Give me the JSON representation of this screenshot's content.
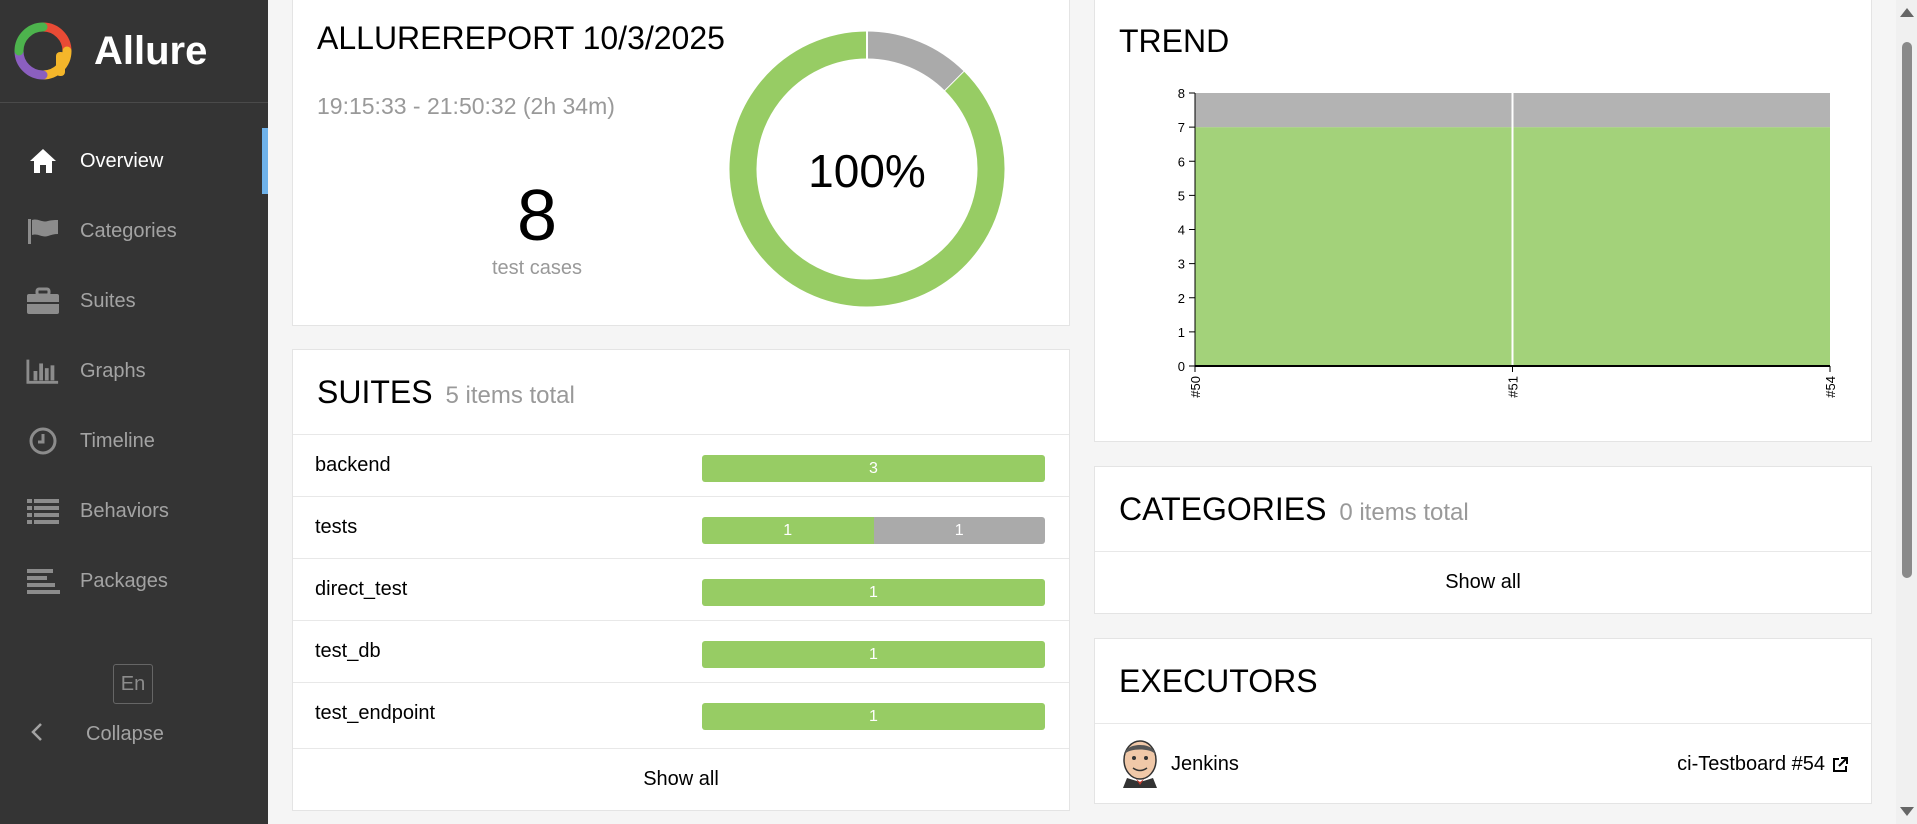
{
  "brand": {
    "name": "Allure"
  },
  "sidebar": {
    "items": [
      {
        "label": "Overview",
        "icon": "home-icon",
        "active": true
      },
      {
        "label": "Categories",
        "icon": "flag-icon"
      },
      {
        "label": "Suites",
        "icon": "briefcase-icon"
      },
      {
        "label": "Graphs",
        "icon": "bar-chart-icon"
      },
      {
        "label": "Timeline",
        "icon": "clock-icon"
      },
      {
        "label": "Behaviors",
        "icon": "list-icon"
      },
      {
        "label": "Packages",
        "icon": "align-left-icon"
      }
    ],
    "language": "En",
    "collapse_label": "Collapse"
  },
  "summary": {
    "title": "ALLUREREPORT 10/3/2025",
    "time_range": "19:15:33 - 21:50:32 (2h 34m)",
    "test_count": "8",
    "test_count_label": "test cases",
    "success_rate": "100%",
    "donut": {
      "passed": 7,
      "unknown": 1
    }
  },
  "suites": {
    "title": "SUITES",
    "subtitle": "5 items total",
    "rows": [
      {
        "name": "backend",
        "segments": [
          {
            "status": "passed",
            "count": 3
          }
        ]
      },
      {
        "name": "tests",
        "segments": [
          {
            "status": "passed",
            "count": 1
          },
          {
            "status": "unknown",
            "count": 1
          }
        ]
      },
      {
        "name": "direct_test",
        "segments": [
          {
            "status": "passed",
            "count": 1
          }
        ]
      },
      {
        "name": "test_db",
        "segments": [
          {
            "status": "passed",
            "count": 1
          }
        ]
      },
      {
        "name": "test_endpoint",
        "segments": [
          {
            "status": "passed",
            "count": 1
          }
        ]
      }
    ],
    "show_all": "Show all"
  },
  "trend": {
    "title": "TREND"
  },
  "chart_data": {
    "type": "area",
    "title": "TREND",
    "x": [
      "#50",
      "#51",
      "#54"
    ],
    "series": [
      {
        "status": "passed",
        "values": [
          7,
          7,
          7
        ]
      },
      {
        "status": "unknown",
        "values": [
          1,
          1,
          1
        ]
      }
    ],
    "yticks": [
      0,
      1,
      2,
      3,
      4,
      5,
      6,
      7,
      8
    ],
    "ylim": [
      0,
      8
    ],
    "stacked": true,
    "colors": {
      "passed": "#a3d27a",
      "unknown": "#b3b3b3"
    }
  },
  "categories": {
    "title": "CATEGORIES",
    "subtitle": "0 items total",
    "show_all": "Show all"
  },
  "executors": {
    "title": "EXECUTORS",
    "name": "Jenkins",
    "build": "ci-Testboard #54"
  },
  "colors": {
    "passed": "#97cc64",
    "unknown": "#aaaaaa",
    "sidebar": "#343434",
    "accent": "#6fb2ea"
  }
}
